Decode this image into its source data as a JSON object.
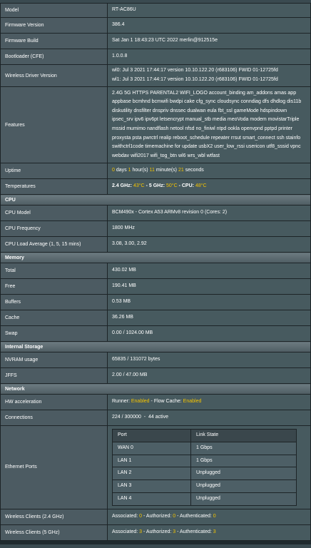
{
  "system": {
    "model_label": "Model",
    "model": "RT-AC86U",
    "firmware_label": "Firmware Version",
    "firmware": "386.4",
    "build_label": "Firmware Build",
    "build": "Sat Jan 1 18:43:23 UTC 2022 merlin@912515e",
    "bootloader_label": "Bootloader (CFE)",
    "bootloader": "1.0.0.8",
    "driver_label": "Wireless Driver Version",
    "driver_line1": "wl0: Jul 3 2021 17:44:17 version 10.10.122.20 (r683106) FWID 01-12725fd",
    "driver_line2": "wl1: Jul 3 2021 17:44:17 version 10.10.122.20 (r683106) FWID 01-12725fd",
    "features_label": "Features",
    "features": "2.4G 5G HTTPS PARENTAL2 WIFI_LOGO account_binding am_addons amas app appbase bcmhnd bcmwifi bwdpi cake cfg_sync cloudsync conndiag dfs dhdlog dis11b diskutility dnsfilter dnspriv dnssec dualwan eula fbt_ssl gameMode hdspindown ipsec_srv ipv6 ipv6pt letsencrypt manual_stb media meoVoda modem movistarTriple mssid mumimo nandflash netool nfsd no_finiwl ntpd ookla openvpnd pptpd printer proxysta psta pwrctrl realip reboot_schedule repeater rrsut smart_connect ssh stainfo swithctrl1code timemachine for update usbX2 user_low_rssi usericon utf8_sssid vpnc webdav wifi2017 wifi_tog_btn wl6 wrs_wbl wtfast",
    "uptime_label": "Uptime",
    "uptime": {
      "days": "0",
      "days_unit": "days",
      "hours": "1",
      "hours_unit": "hour(s)",
      "minutes": "11",
      "minutes_unit": "minute(s)",
      "seconds": "21",
      "seconds_unit": "seconds"
    },
    "temps_label": "Temperatures",
    "temps": {
      "t24_label": "2.4 GHz:",
      "t24": "43°C",
      "sep1": "-",
      "t5_label": "5 GHz:",
      "t5": "50°C",
      "sep2": "-",
      "cpu_label": "CPU:",
      "cpu": "48°C"
    }
  },
  "cpu": {
    "title": "CPU",
    "model_label": "CPU Model",
    "model": "BCM490x - Cortex A53 ARMv8 revision 0   (Cores: 2)",
    "freq_label": "CPU Frequency",
    "freq": "1800 MHz",
    "load_label": "CPU Load Average (1, 5, 15 mins)",
    "load": "3.08, 3.00, 2.92"
  },
  "memory": {
    "title": "Memory",
    "total_label": "Total",
    "total": "430.02 MB",
    "free_label": "Free",
    "free": "190.41 MB",
    "buffers_label": "Buffers",
    "buffers": "0.53 MB",
    "cache_label": "Cache",
    "cache": "36.26 MB",
    "swap_label": "Swap",
    "swap": "0.00 / 1024.00 MB"
  },
  "storage": {
    "title": "Internal Storage",
    "nvram_label": "NVRAM usage",
    "nvram": "65835 / 131072 bytes",
    "jffs_label": "JFFS",
    "jffs": "2.00 / 47.00 MB"
  },
  "network": {
    "title": "Network",
    "hw_label": "HW acceleration",
    "hw": {
      "runner_label": "Runner:",
      "runner": "Enabled",
      "sep": "-",
      "flow_label": "Flow Cache:",
      "flow": "Enabled"
    },
    "conn_label": "Connections",
    "conn": "224 / 300000  -  44 active",
    "ports_label": "Ethernet Ports",
    "ports_header": {
      "port": "Port",
      "state": "Link State"
    },
    "ports": [
      {
        "port": "WAN 0",
        "state": "1 Gbps"
      },
      {
        "port": "LAN 1",
        "state": "1 Gbps"
      },
      {
        "port": "LAN 2",
        "state": "Unplugged"
      },
      {
        "port": "LAN 3",
        "state": "Unplugged"
      },
      {
        "port": "LAN 4",
        "state": "Unplugged"
      }
    ],
    "wc24_label": "Wireless Clients (2.4 GHz)",
    "wc24": {
      "assoc_label": "Associated:",
      "assoc": "0",
      "auth_label": "Authorized:",
      "auth": "0",
      "authn_label": "Authenticated:",
      "authn": "0",
      "sep": "-"
    },
    "wc5_label": "Wireless Clients (5 GHz)",
    "wc5": {
      "assoc_label": "Associated:",
      "assoc": "3",
      "auth_label": "Authorized:",
      "auth": "3",
      "authn_label": "Authenticated:",
      "authn": "3",
      "sep": "-"
    }
  },
  "colors": {
    "highlight": "#f5c400",
    "section_header": "#5d6b71",
    "label_cell": "#4c5b62",
    "value_cell": "#475a5f"
  }
}
